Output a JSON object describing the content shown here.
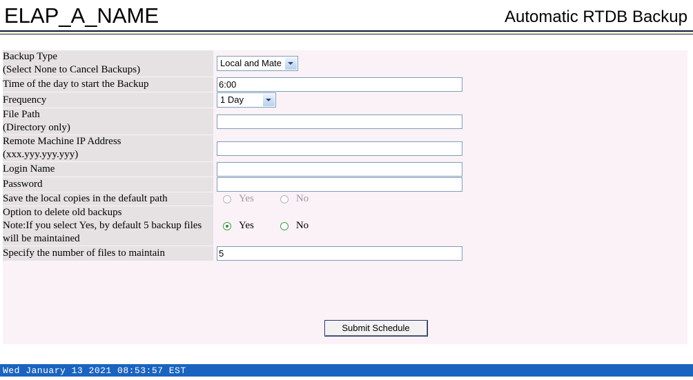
{
  "header": {
    "system_name": "ELAP_A_NAME",
    "page_title": "Automatic RTDB Backup"
  },
  "form": {
    "rows": [
      {
        "label_line1": "Backup Type",
        "label_line2": "(Select None to Cancel Backups)",
        "control": "select",
        "value": "Local and Mate"
      },
      {
        "label_line1": "Time of the day to start the Backup",
        "label_line2": "",
        "control": "text",
        "value": "6:00"
      },
      {
        "label_line1": "Frequency",
        "label_line2": "",
        "control": "select",
        "value": "1 Day"
      },
      {
        "label_line1": "File Path",
        "label_line2": "(Directory only)",
        "control": "text",
        "value": ""
      },
      {
        "label_line1": "Remote Machine IP Address",
        "label_line2": "(xxx.yyy.yyy.yyy)",
        "control": "text",
        "value": ""
      },
      {
        "label_line1": "Login Name",
        "label_line2": "",
        "control": "text",
        "value": ""
      },
      {
        "label_line1": "Password",
        "label_line2": "",
        "control": "text",
        "value": ""
      },
      {
        "label_line1": "Save the local copies in the default path",
        "label_line2": "",
        "control": "radio",
        "value": ""
      },
      {
        "label_line1": "Option to delete old backups",
        "label_line2": "Note:If you select Yes, by default 5 backup files",
        "label_line3": "will be maintained",
        "control": "radio",
        "value": "Yes"
      },
      {
        "label_line1": "Specify the number of files to maintain",
        "label_line2": "",
        "control": "text",
        "value": "5"
      }
    ],
    "radio_yes_label": "Yes",
    "radio_no_label": "No",
    "text_placeholder": ""
  },
  "actions": {
    "submit_label": "Submit Schedule"
  },
  "status": {
    "timestamp": "Wed January 13 2021 08:53:57 EST"
  },
  "colors": {
    "status_bar": "#1a64bf",
    "label_cell": "#e6e2e4",
    "panel": "#faf2f6",
    "rule_dark": "#0d1340",
    "rule_light": "#fbf8d4",
    "radio_checked": "#2f8a39",
    "input_border": "#7e9db9"
  }
}
